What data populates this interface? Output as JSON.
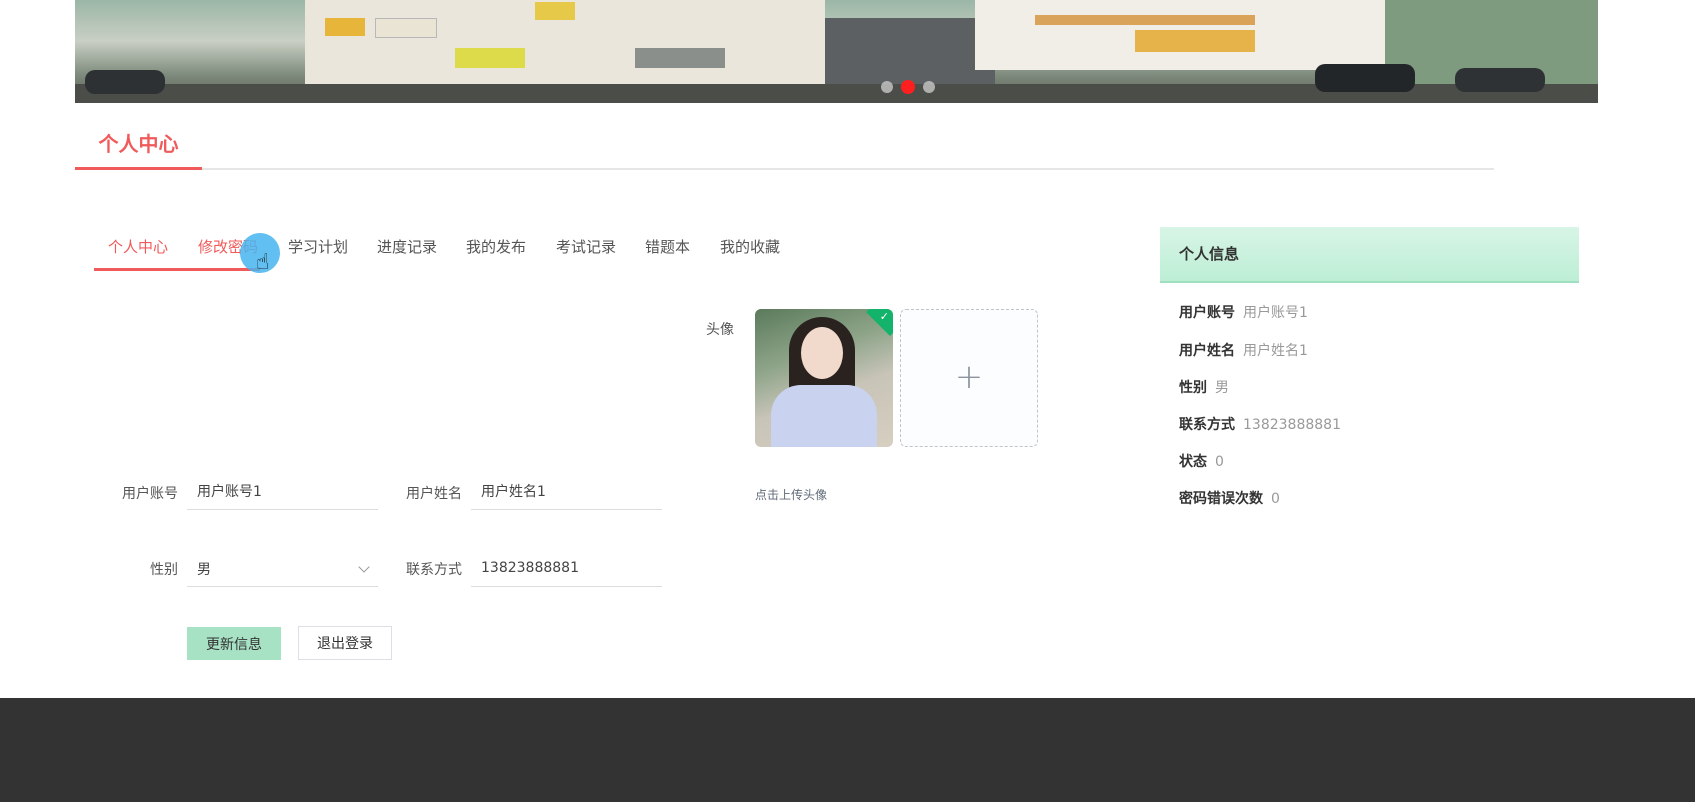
{
  "section": {
    "title": "个人中心"
  },
  "banner": {
    "dots": [
      false,
      true,
      false
    ]
  },
  "tabs": [
    {
      "label": "个人中心",
      "active": true
    },
    {
      "label": "修改密码"
    },
    {
      "label": "学习计划"
    },
    {
      "label": "进度记录"
    },
    {
      "label": "我的发布"
    },
    {
      "label": "考试记录"
    },
    {
      "label": "错题本"
    },
    {
      "label": "我的收藏"
    }
  ],
  "form": {
    "avatar_label": "头像",
    "upload_hint": "点击上传头像",
    "account_label": "用户账号",
    "account_value": "用户账号1",
    "name_label": "用户姓名",
    "name_value": "用户姓名1",
    "gender_label": "性别",
    "gender_value": "男",
    "phone_label": "联系方式",
    "phone_value": "13823888881",
    "update_button": "更新信息",
    "logout_button": "退出登录"
  },
  "info": {
    "title": "个人信息",
    "rows": [
      {
        "k": "用户账号",
        "v": "用户账号1"
      },
      {
        "k": "用户姓名",
        "v": "用户姓名1"
      },
      {
        "k": "性别",
        "v": "男"
      },
      {
        "k": "联系方式",
        "v": "13823888881"
      },
      {
        "k": "状态",
        "v": "0"
      },
      {
        "k": "密码错误次数",
        "v": "0"
      }
    ]
  },
  "colors": {
    "accent": "#f05a5a",
    "primary_button": "#a7e2c4",
    "footer": "#333333"
  }
}
